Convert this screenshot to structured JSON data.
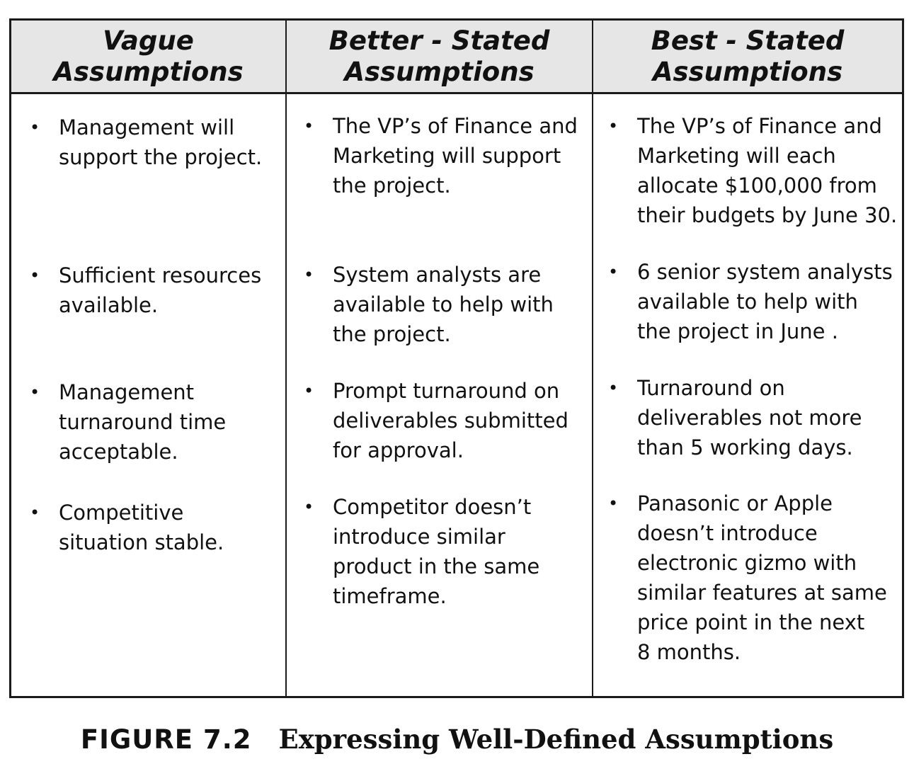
{
  "table": {
    "headers": [
      "Vague\nAssumptions",
      "Better - Stated\nAssumptions",
      "Best - Stated\nAssumptions"
    ],
    "columns": [
      {
        "items": [
          "Management will\nsupport the project.",
          "Sufficient resources\navailable.",
          "Management\nturnaround time\nacceptable.",
          "Competitive\nsituation stable."
        ]
      },
      {
        "items": [
          "The VP’s of Finance and\nMarketing will support\nthe project.",
          "System analysts are\navailable to help with\nthe project.",
          "Prompt turnaround on\ndeliverables submitted\nfor approval.",
          "Competitor doesn’t\nintroduce similar\nproduct in the same\ntimeframe."
        ]
      },
      {
        "items": [
          "The VP’s of Finance and\nMarketing will each\nallocate $100,000 from\ntheir budgets by June 30.",
          "6 senior system analysts\navailable to help with\nthe  project in June .",
          "Turnaround on\ndeliverables not more\nthan 5 working days.",
          "Panasonic or Apple\ndoesn’t introduce\nelectronic gizmo with\nsimilar features at same\nprice point in the next\n8 months."
        ]
      }
    ]
  },
  "caption": {
    "label": "FIGURE 7.2",
    "title": "Expressing Well-Defined Assumptions"
  },
  "colors": {
    "header_background": "#e6e6e6",
    "border": "#1a1a1a",
    "text": "#111111"
  }
}
